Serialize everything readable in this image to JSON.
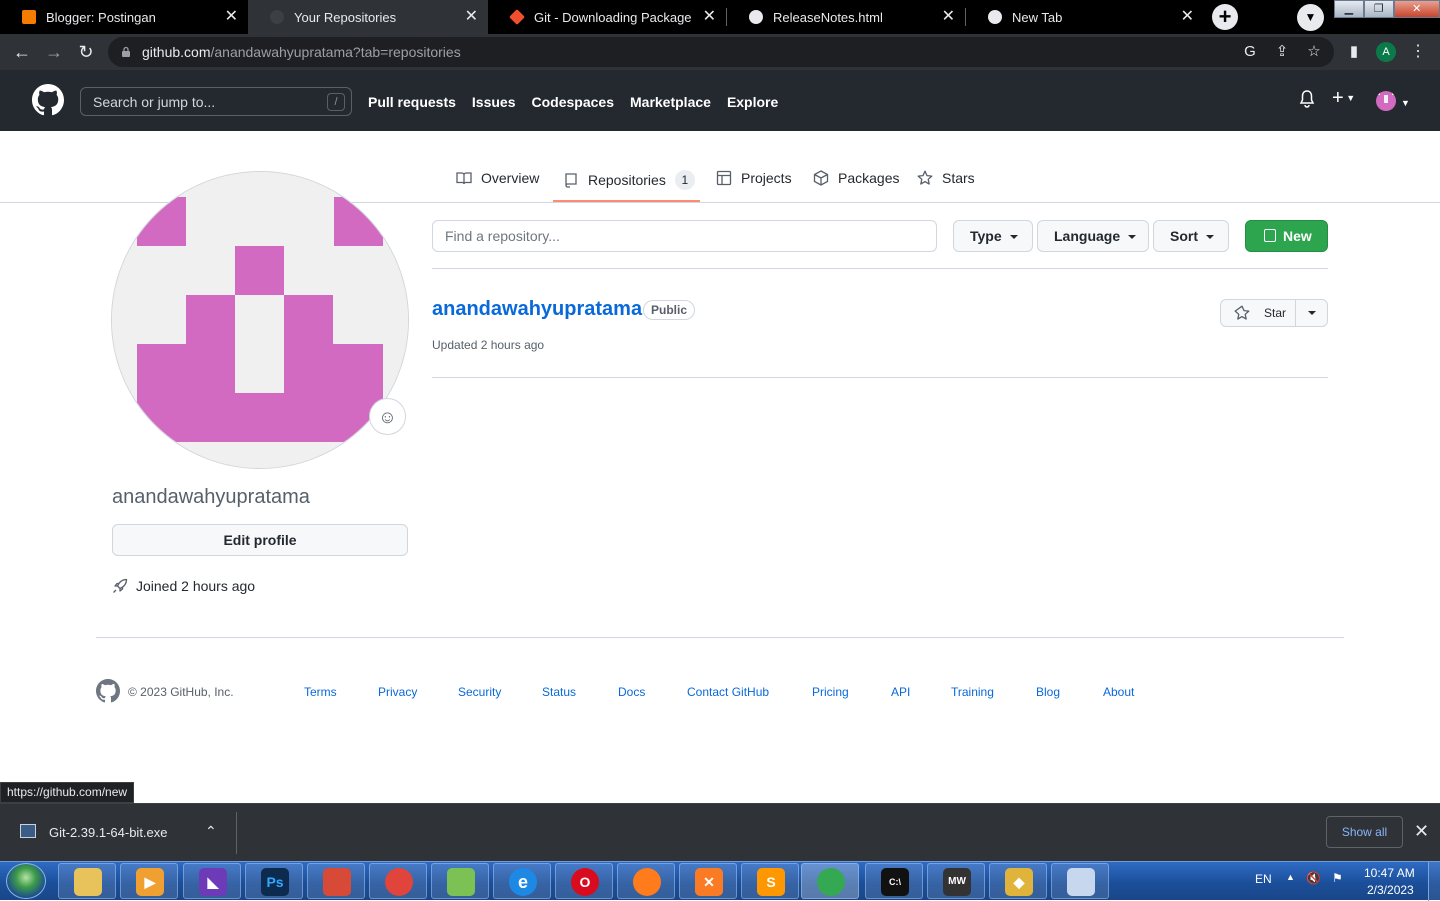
{
  "browser": {
    "tabs": [
      {
        "title": "Blogger: Postingan",
        "favicon_color": "#f57c00"
      },
      {
        "title": "Your Repositories",
        "favicon_color": "#24292f"
      },
      {
        "title": "Git - Downloading Package",
        "favicon_color": "#f1502f"
      },
      {
        "title": "ReleaseNotes.html",
        "favicon_color": "#e8eaed"
      },
      {
        "title": "New Tab",
        "favicon_color": "#e8eaed"
      }
    ],
    "url_host": "github.com",
    "url_path": "/anandawahyupratama?tab=repositories",
    "profile_initial": "A"
  },
  "github": {
    "search_placeholder": "Search or jump to...",
    "search_shortcut": "/",
    "nav": [
      "Pull requests",
      "Issues",
      "Codespaces",
      "Marketplace",
      "Explore"
    ],
    "plus_label": "+"
  },
  "profile_tabs": [
    {
      "label": "Overview",
      "icon": "book-icon"
    },
    {
      "label": "Repositories",
      "icon": "repo-icon",
      "count": "1",
      "selected": true
    },
    {
      "label": "Projects",
      "icon": "table-icon"
    },
    {
      "label": "Packages",
      "icon": "package-icon"
    },
    {
      "label": "Stars",
      "icon": "star-icon"
    }
  ],
  "profile": {
    "username": "anandawahyupratama",
    "edit_label": "Edit profile",
    "joined": "Joined 2 hours ago",
    "avatar_color": "#d26ac2"
  },
  "repo_filter": {
    "placeholder": "Find a repository...",
    "type_label": "Type",
    "language_label": "Language",
    "sort_label": "Sort",
    "new_label": "New"
  },
  "repos": [
    {
      "name": "anandawahyupratama",
      "visibility": "Public",
      "updated": "Updated 2 hours ago",
      "star_label": "Star"
    }
  ],
  "footer": {
    "copyright": "© 2023 GitHub, Inc.",
    "links": [
      "Terms",
      "Privacy",
      "Security",
      "Status",
      "Docs",
      "Contact GitHub",
      "Pricing",
      "API",
      "Training",
      "Blog",
      "About"
    ]
  },
  "status_url": "https://github.com/new",
  "download": {
    "file_name": "Git-2.39.1-64-bit.exe",
    "show_all_label": "Show all"
  },
  "taskbar": {
    "language": "EN",
    "time": "10:47 AM",
    "date": "2/3/2023"
  },
  "colors": {
    "accent_green": "#2da44e",
    "link_blue": "#0969da",
    "tab_underline": "#fd8c73",
    "header_dark": "#24292f"
  }
}
